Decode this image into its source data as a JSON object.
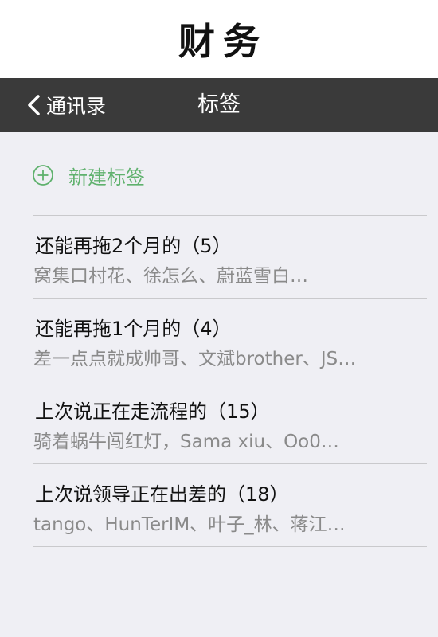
{
  "caption": {
    "title": "财务"
  },
  "navbar": {
    "back_label": "通讯录",
    "title": "标签"
  },
  "new_tag": {
    "label": "新建标签"
  },
  "tags": [
    {
      "title": "还能再拖2个月的（5）",
      "members": "窝集口村花、徐怎么、蔚蓝雪白…"
    },
    {
      "title": "还能再拖1个月的（4）",
      "members": "差一点点就成帅哥、文斌brother、JS…"
    },
    {
      "title": "上次说正在走流程的（15）",
      "members": "骑着蜗牛闯红灯，Sama xiu、Oo0…"
    },
    {
      "title": "上次说领导正在出差的（18）",
      "members": "tango、HunTerIM、叶子_林、蒋江…"
    }
  ],
  "colors": {
    "navbar_bg": "#3a3a3a",
    "accent_green": "#5fb16d",
    "list_bg": "#efeff4",
    "secondary_text": "#8a8a8a"
  },
  "icons": {
    "back": "chevron-left-icon",
    "new_tag": "plus-circle-icon"
  }
}
